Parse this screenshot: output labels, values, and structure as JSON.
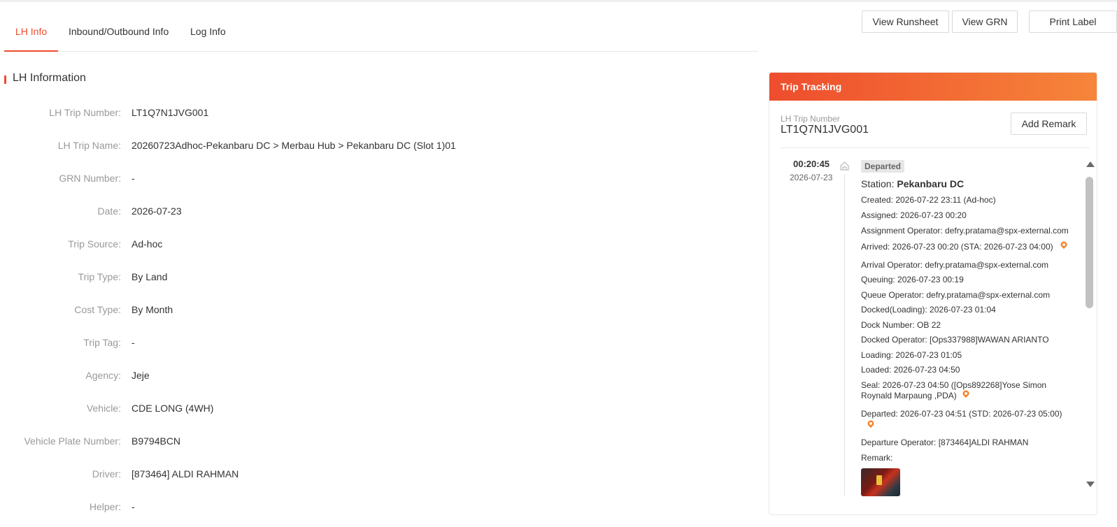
{
  "tabs": [
    {
      "label": "LH Info",
      "active": true
    },
    {
      "label": "Inbound/Outbound Info",
      "active": false
    },
    {
      "label": "Log Info",
      "active": false
    }
  ],
  "actions": {
    "view_runsheet": "View Runsheet",
    "view_grn": "View GRN",
    "print_label": "Print Label"
  },
  "section_title": "LH Information",
  "fields": [
    {
      "label": "LH Trip Number:",
      "value": "LT1Q7N1JVG001"
    },
    {
      "label": "LH Trip Name:",
      "value": "20260723Adhoc-Pekanbaru DC > Merbau Hub > Pekanbaru DC (Slot 1)01"
    },
    {
      "label": "GRN Number:",
      "value": "-"
    },
    {
      "label": "Date:",
      "value": "2026-07-23"
    },
    {
      "label": "Trip Source:",
      "value": "Ad-hoc"
    },
    {
      "label": "Trip Type:",
      "value": "By Land"
    },
    {
      "label": "Cost Type:",
      "value": "By Month"
    },
    {
      "label": "Trip Tag:",
      "value": "-"
    },
    {
      "label": "Agency:",
      "value": "Jeje"
    },
    {
      "label": "Vehicle:",
      "value": "CDE LONG (4WH)"
    },
    {
      "label": "Vehicle Plate Number:",
      "value": "B9794BCN"
    },
    {
      "label": "Driver:",
      "value": "[873464] ALDI RAHMAN"
    },
    {
      "label": "Helper:",
      "value": "-"
    }
  ],
  "tracking": {
    "title": "Trip Tracking",
    "trip_number_label": "LH Trip Number",
    "trip_number": "LT1Q7N1JVG001",
    "add_remark": "Add Remark",
    "time": "00:20:45",
    "date": "2026-07-23",
    "status": "Departed",
    "station_label": "Station:",
    "station_name": "Pekanbaru DC",
    "events": {
      "created": "Created: 2026-07-22 23:11 (Ad-hoc)",
      "assigned": "Assigned: 2026-07-23 00:20",
      "assignment_operator": "Assignment Operator: defry.pratama@spx-external.com",
      "arrived": "Arrived: 2026-07-23 00:20 (STA: 2026-07-23 04:00)",
      "arrival_operator": "Arrival Operator: defry.pratama@spx-external.com",
      "queuing": "Queuing: 2026-07-23 00:19",
      "queue_operator": "Queue Operator: defry.pratama@spx-external.com",
      "docked_loading": "Docked(Loading): 2026-07-23 01:04",
      "dock_number": "Dock Number: OB 22",
      "docked_operator": "Docked Operator: [Ops337988]WAWAN ARIANTO",
      "loading": "Loading: 2026-07-23 01:05",
      "loaded": "Loaded: 2026-07-23 04:50",
      "seal": "Seal: 2026-07-23 04:50 ([Ops892268]Yose Simon Roynald Marpaung ,PDA)",
      "departed": "Departed: 2026-07-23 04:51 (STD: 2026-07-23 05:00)",
      "departure_operator": "Departure Operator: [873464]ALDI RAHMAN",
      "remark": "Remark:"
    }
  },
  "colors": {
    "accent": "#ee4d2d",
    "header_gradient_end": "#f6853a",
    "pin": "#f5822a"
  }
}
